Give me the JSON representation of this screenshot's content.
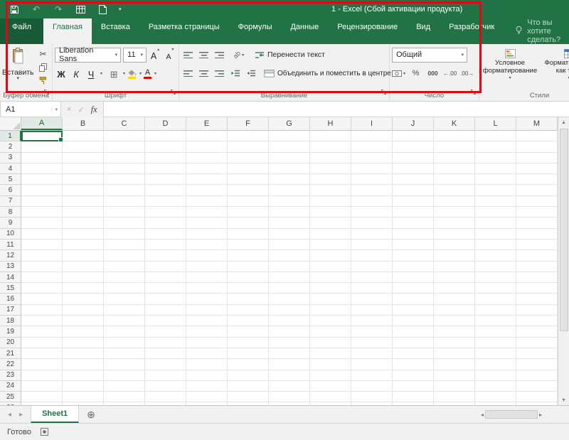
{
  "colors": {
    "accent_green": "#217346",
    "annotation_red": "#e30613"
  },
  "title_bar": {
    "title": "1 - Excel (Сбой активации продукта)"
  },
  "tabs": [
    {
      "label": "Файл"
    },
    {
      "label": "Главная"
    },
    {
      "label": "Вставка"
    },
    {
      "label": "Разметка страницы"
    },
    {
      "label": "Формулы"
    },
    {
      "label": "Данные"
    },
    {
      "label": "Рецензирование"
    },
    {
      "label": "Вид"
    },
    {
      "label": "Разработчик"
    }
  ],
  "tell_me": {
    "label": "Что вы хотите сделать?"
  },
  "ribbon": {
    "clipboard": {
      "paste_label": "Вставить",
      "group_label": "Буфер обмена"
    },
    "font": {
      "font_name": "Liberation Sans",
      "font_size": "11",
      "bold": "Ж",
      "italic": "К",
      "underline": "Ч",
      "cyr_a": "А",
      "group_label": "Шрифт"
    },
    "alignment": {
      "wrap_text": "Перенести текст",
      "merge_center": "Объединить и поместить в центре",
      "group_label": "Выравнивание"
    },
    "number": {
      "format": "Общий",
      "percent": "%",
      "thousands": "000",
      "group_label": "Число"
    },
    "styles": {
      "conditional": "Условное форматирование",
      "format_table": "Форматировать как табл",
      "group_label": "Стили"
    }
  },
  "formula_bar": {
    "name_box": "A1",
    "fx": "fx"
  },
  "grid": {
    "columns": [
      "A",
      "B",
      "C",
      "D",
      "E",
      "F",
      "G",
      "H",
      "I",
      "J",
      "K",
      "L",
      "M"
    ],
    "row_count": 26,
    "selected_cell": "A1"
  },
  "sheet_bar": {
    "sheets": [
      {
        "name": "Sheet1",
        "active": true
      }
    ]
  },
  "status_bar": {
    "status": "Готово"
  },
  "icons": {
    "caret_down": "▾",
    "caret_up": "▴",
    "scissors": "✂",
    "check": "✓",
    "close": "×",
    "plus_circle": "⊕",
    "tri_left": "◂",
    "tri_right": "▸",
    "borders": "⊞",
    "orientation": "ab",
    "inc_decimal": "←.00",
    "dec_decimal": ".00→"
  }
}
